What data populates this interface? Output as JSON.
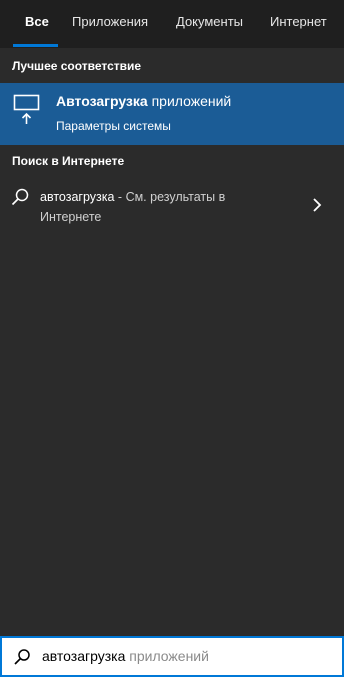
{
  "tabs": [
    {
      "label": "Все",
      "active": true
    },
    {
      "label": "Приложения"
    },
    {
      "label": "Документы"
    },
    {
      "label": "Интернет"
    }
  ],
  "best_match": {
    "heading": "Лучшее соответствие",
    "title_bold": "Автозагрузка",
    "title_rest": " приложений",
    "subtitle": "Параметры системы",
    "icon": "display-settings-icon"
  },
  "web_search": {
    "heading": "Поиск в Интернете",
    "query": "автозагрузка",
    "separator": " - ",
    "hint": "См. результаты в Интернете",
    "icon": "search-icon"
  },
  "search_box": {
    "typed": "автозагрузка",
    "autocomplete": " приложений"
  },
  "colors": {
    "accent": "#0078d7",
    "selected_row": "#1b5c96",
    "panel": "#2b2b2b",
    "tabbar": "#1f1f1f"
  }
}
